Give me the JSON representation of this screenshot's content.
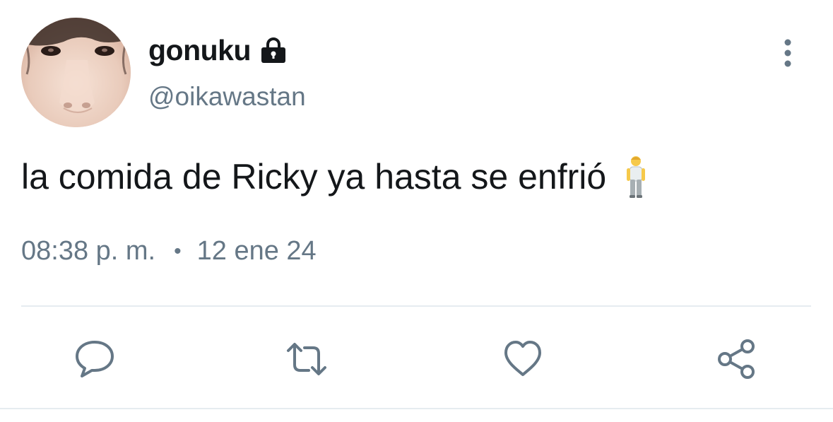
{
  "tweet": {
    "display_name": "gonuku",
    "handle": "@oikawastan",
    "text": "la comida de Ricky ya hasta se enfrió",
    "time": "08:38 p. m.",
    "separator": "•",
    "date": "12 ene 24",
    "protected": true,
    "emoji": "person-standing-icon"
  },
  "actions": [
    {
      "name": "reply",
      "icon": "reply-bubble-icon"
    },
    {
      "name": "retweet",
      "icon": "retweet-icon"
    },
    {
      "name": "like",
      "icon": "heart-icon"
    },
    {
      "name": "share",
      "icon": "share-icon"
    }
  ],
  "colors": {
    "text": "#14171a",
    "secondary": "#657786",
    "icon": "#657786",
    "divider": "#e6ecf0",
    "background": "#ffffff"
  }
}
